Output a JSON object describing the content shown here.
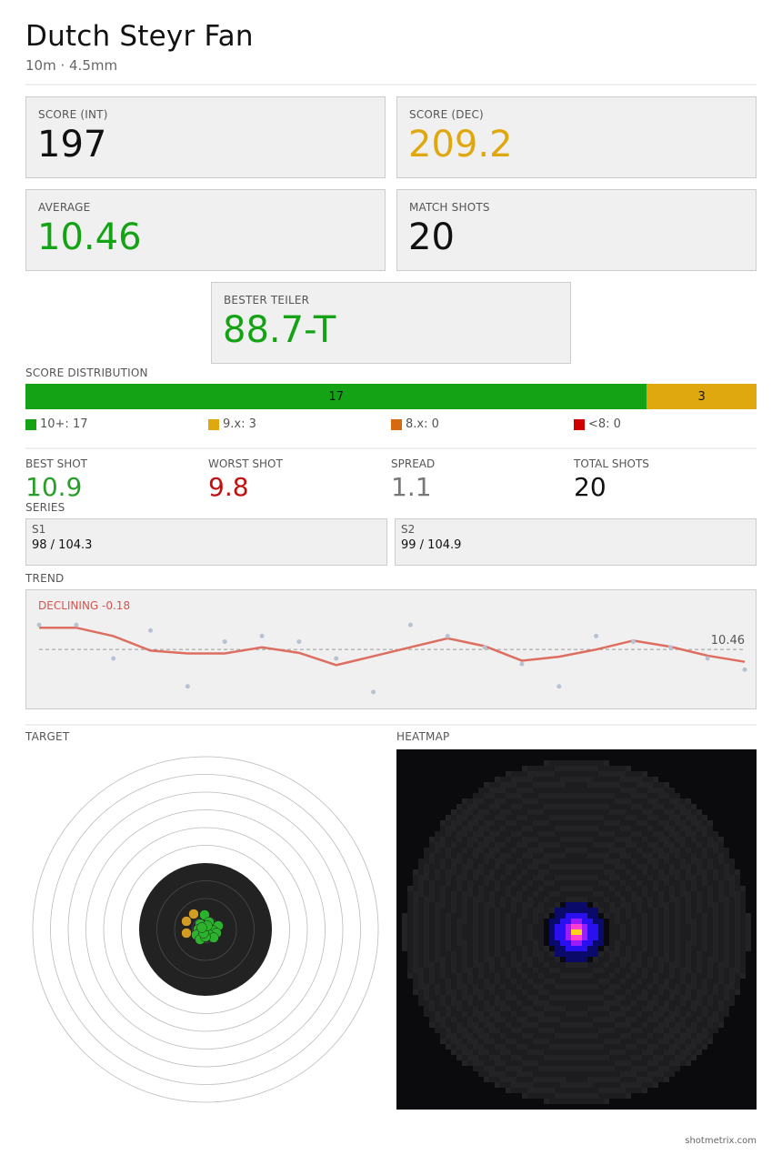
{
  "header": {
    "title": "Dutch Steyr Fan",
    "subtitle": "10m  ·  4.5mm"
  },
  "cards": {
    "score_int": {
      "label": "SCORE (INT)",
      "value": "197"
    },
    "score_dec": {
      "label": "SCORE (DEC)",
      "value": "209.2"
    },
    "average": {
      "label": "AVERAGE",
      "value": "10.46"
    },
    "match_shots": {
      "label": "MATCH SHOTS",
      "value": "20"
    },
    "bester_teiler": {
      "label": "BESTER TEILER",
      "value": "88.7-T"
    }
  },
  "distribution": {
    "label": "SCORE DISTRIBUTION",
    "bar": [
      {
        "text": "17",
        "count": 17,
        "color": "#14a314"
      },
      {
        "text": "3",
        "count": 3,
        "color": "#e0a80f"
      }
    ],
    "legend": [
      {
        "text": "10+: 17",
        "color": "#14a314"
      },
      {
        "text": "9.x: 3",
        "color": "#e0a80f"
      },
      {
        "text": "8.x: 0",
        "color": "#d66a0f"
      },
      {
        "text": "<8: 0",
        "color": "#d00000"
      }
    ]
  },
  "stats": {
    "best": {
      "label": "BEST SHOT",
      "value": "10.9",
      "color": "#2a9e2a"
    },
    "worst": {
      "label": "WORST SHOT",
      "value": "9.8",
      "color": "#c01010"
    },
    "spread": {
      "label": "SPREAD",
      "value": "1.1",
      "color": "#777777"
    },
    "total": {
      "label": "TOTAL SHOTS",
      "value": "20",
      "color": "#111111"
    }
  },
  "series": {
    "label": "SERIES",
    "items": [
      {
        "label": "S1",
        "value": "98 / 104.3"
      },
      {
        "label": "S2",
        "value": "99 / 104.9"
      }
    ]
  },
  "trend": {
    "label": "TREND",
    "status": "DECLINING -0.18",
    "status_color": "#d9534f",
    "average_label": "10.46"
  },
  "chart_data": {
    "type": "line",
    "x": [
      1,
      2,
      3,
      4,
      5,
      6,
      7,
      8,
      9,
      10,
      11,
      12,
      13,
      14,
      15,
      16,
      17,
      18,
      19,
      20
    ],
    "series": [
      {
        "values": [
          10.9,
          10.9,
          10.3,
          10.8,
          9.8,
          10.6,
          10.7,
          10.6,
          10.3,
          9.7,
          10.9,
          10.7,
          10.5,
          10.2,
          9.8,
          10.7,
          10.6,
          10.5,
          10.3,
          10.1
        ]
      }
    ],
    "moving_average": [
      10.85,
      10.85,
      10.7,
      10.44,
      10.39,
      10.39,
      10.5,
      10.4,
      10.18,
      10.34,
      10.5,
      10.66,
      10.52,
      10.26,
      10.33,
      10.46,
      10.62,
      10.51,
      10.35,
      10.24
    ],
    "average": 10.46,
    "ylim": [
      9.6,
      11.0
    ],
    "line_color": "#dd6e60",
    "point_color": "#b8c2d4"
  },
  "target": {
    "label": "TARGET",
    "shots": [
      {
        "dx": -13,
        "dy": -17,
        "color": "#d29c23"
      },
      {
        "dx": -21,
        "dy": -9,
        "color": "#d29c23"
      },
      {
        "dx": -21,
        "dy": 4,
        "color": "#d29c23"
      },
      {
        "dx": -1,
        "dy": -16,
        "color": "#2db22d"
      },
      {
        "dx": 4,
        "dy": -8,
        "color": "#2db22d"
      },
      {
        "dx": -6,
        "dy": -6,
        "color": "#2db22d"
      },
      {
        "dx": 14,
        "dy": -4,
        "color": "#2db22d"
      },
      {
        "dx": 1,
        "dy": -2,
        "color": "#2db22d"
      },
      {
        "dx": -8,
        "dy": 0,
        "color": "#2db22d"
      },
      {
        "dx": 8,
        "dy": 1,
        "color": "#2db22d"
      },
      {
        "dx": 12,
        "dy": 4,
        "color": "#2db22d"
      },
      {
        "dx": -3,
        "dy": 3,
        "color": "#2db22d"
      },
      {
        "dx": -10,
        "dy": 6,
        "color": "#2db22d"
      },
      {
        "dx": 4,
        "dy": 6,
        "color": "#2db22d"
      },
      {
        "dx": 9,
        "dy": 9,
        "color": "#2db22d"
      },
      {
        "dx": -6,
        "dy": 11,
        "color": "#2db22d"
      },
      {
        "dx": 0,
        "dy": 8,
        "color": "#2db22d"
      },
      {
        "dx": -2,
        "dy": 4,
        "color": "#2db22d"
      },
      {
        "dx": 2,
        "dy": -4,
        "color": "#2db22d"
      },
      {
        "dx": -4,
        "dy": -2,
        "color": "#2db22d"
      }
    ]
  },
  "heatmap": {
    "label": "HEATMAP"
  },
  "footer": {
    "text": "shotmetrix.com"
  }
}
